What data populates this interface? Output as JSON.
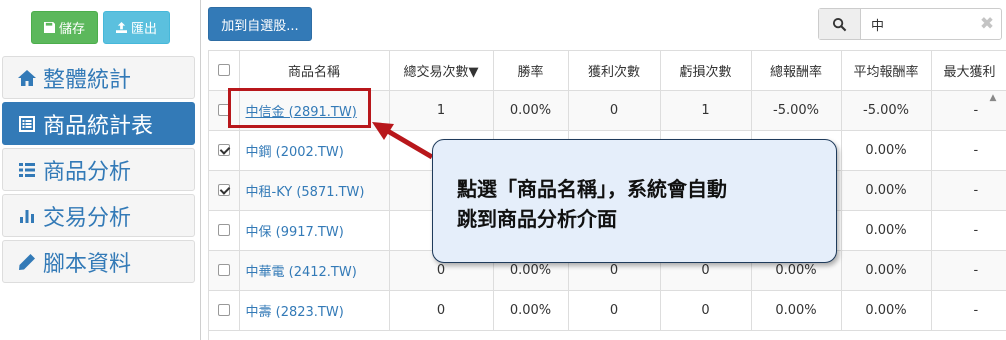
{
  "toolbar_left": {
    "save_label": "儲存",
    "export_label": "匯出"
  },
  "sidebar": {
    "items": [
      {
        "label": "整體統計",
        "icon": "home-icon",
        "active": false
      },
      {
        "label": "商品統計表",
        "icon": "list-alt-icon",
        "active": true
      },
      {
        "label": "商品分析",
        "icon": "list-icon",
        "active": false
      },
      {
        "label": "交易分析",
        "icon": "bar-chart-icon",
        "active": false
      },
      {
        "label": "腳本資料",
        "icon": "pencil-icon",
        "active": false
      }
    ]
  },
  "toolbar": {
    "add_watchlist_label": "加到自選股..."
  },
  "search": {
    "value": "中",
    "placeholder": ""
  },
  "table": {
    "headers": [
      "商品名稱",
      "總交易次數▼",
      "勝率",
      "獲利次數",
      "虧損次數",
      "總報酬率",
      "平均報酬率",
      "最大獲利"
    ],
    "rows": [
      {
        "checked": false,
        "name": "中信金 (2891.TW)",
        "total": "1",
        "win_rate": "0.00%",
        "wins": "0",
        "losses": "1",
        "total_return": "-5.00%",
        "avg_return": "-5.00%",
        "max_profit": "-"
      },
      {
        "checked": true,
        "name": "中鋼 (2002.TW)",
        "total": "",
        "win_rate": "",
        "wins": "",
        "losses": "",
        "total_return": "",
        "avg_return": "0.00%",
        "max_profit": "-"
      },
      {
        "checked": true,
        "name": "中租-KY (5871.TW)",
        "total": "",
        "win_rate": "",
        "wins": "",
        "losses": "",
        "total_return": "",
        "avg_return": "0.00%",
        "max_profit": "-"
      },
      {
        "checked": false,
        "name": "中保 (9917.TW)",
        "total": "",
        "win_rate": "",
        "wins": "",
        "losses": "",
        "total_return": "",
        "avg_return": "0.00%",
        "max_profit": "-"
      },
      {
        "checked": false,
        "name": "中華電 (2412.TW)",
        "total": "0",
        "win_rate": "0.00%",
        "wins": "0",
        "losses": "0",
        "total_return": "0.00%",
        "avg_return": "0.00%",
        "max_profit": "-"
      },
      {
        "checked": false,
        "name": "中壽 (2823.TW)",
        "total": "0",
        "win_rate": "0.00%",
        "wins": "0",
        "losses": "0",
        "total_return": "0.00%",
        "avg_return": "0.00%",
        "max_profit": "-"
      }
    ]
  },
  "annotation": {
    "line1": "點選「商品名稱」，系統會自動",
    "line2": "跳到商品分析介面",
    "highlight_color": "#b8171b"
  },
  "colors": {
    "primary": "#337ab7",
    "success": "#5cb85c",
    "info": "#5bc0de"
  }
}
